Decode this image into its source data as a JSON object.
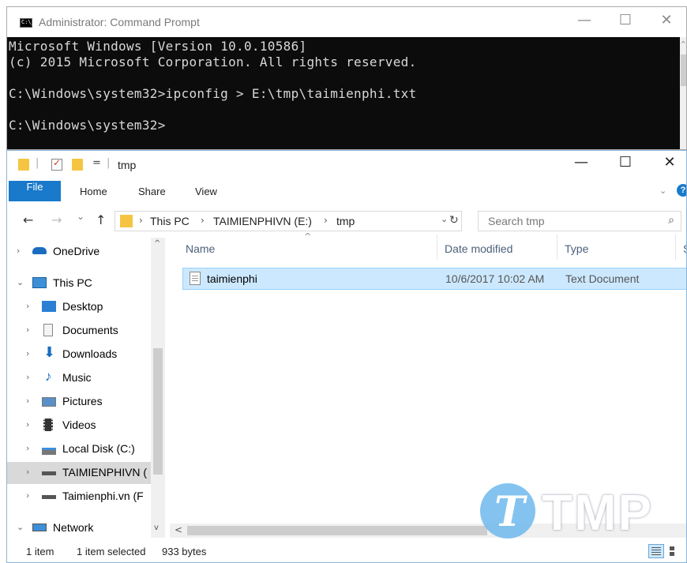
{
  "cmd": {
    "title": "Administrator: Command Prompt",
    "lines": [
      "Microsoft Windows [Version 10.0.10586]",
      "(c) 2015 Microsoft Corporation. All rights reserved.",
      "",
      "C:\\Windows\\system32>ipconfig > E:\\tmp\\taimienphi.txt",
      "",
      "C:\\Windows\\system32>"
    ],
    "min": "—",
    "max": "☐",
    "close": "✕"
  },
  "explorer": {
    "title": "tmp",
    "qa_sep": "|",
    "qa_dropdown": "=",
    "ribbon": {
      "file": "File",
      "home": "Home",
      "share": "Share",
      "view": "View",
      "expand": "⌄",
      "help": "?"
    },
    "nav": {
      "back": "←",
      "forward": "→",
      "recent": "⌄",
      "up": "↑"
    },
    "address": {
      "crumbs": [
        "This PC",
        "TAIMIENPHIVN (E:)",
        "tmp"
      ],
      "sep": "›",
      "dropdown": "⌄"
    },
    "refresh": "↻",
    "search": {
      "placeholder": "Search tmp",
      "icon": "⌕"
    },
    "tree": [
      {
        "label": "OneDrive",
        "exp": "›"
      },
      {
        "label": "This PC",
        "exp": "⌄"
      },
      {
        "label": "Desktop",
        "exp": "›"
      },
      {
        "label": "Documents",
        "exp": "›"
      },
      {
        "label": "Downloads",
        "exp": "›"
      },
      {
        "label": "Music",
        "exp": "›"
      },
      {
        "label": "Pictures",
        "exp": "›"
      },
      {
        "label": "Videos",
        "exp": "›"
      },
      {
        "label": "Local Disk (C:)",
        "exp": "›"
      },
      {
        "label": "TAIMIENPHIVN (",
        "exp": "›"
      },
      {
        "label": "Taimienphi.vn (F",
        "exp": "›"
      },
      {
        "label": "Network",
        "exp": "⌄"
      }
    ],
    "columns": {
      "name": "Name",
      "date": "Date modified",
      "type": "Type",
      "size": "S"
    },
    "sort_arrow": "^",
    "files": [
      {
        "name": "taimienphi",
        "date": "10/6/2017 10:02 AM",
        "type": "Text Document"
      }
    ],
    "scroll": {
      "up": "^",
      "down": "v",
      "left": "<"
    },
    "status": {
      "count": "1 item",
      "selected": "1 item selected",
      "size": "933 bytes"
    }
  },
  "watermark": {
    "letter": "T",
    "text": "TMP"
  },
  "colors": {
    "accent": "#1979ca",
    "selection": "#cce8ff",
    "console_bg": "#0c0c0c",
    "folder": "#f5c542"
  }
}
